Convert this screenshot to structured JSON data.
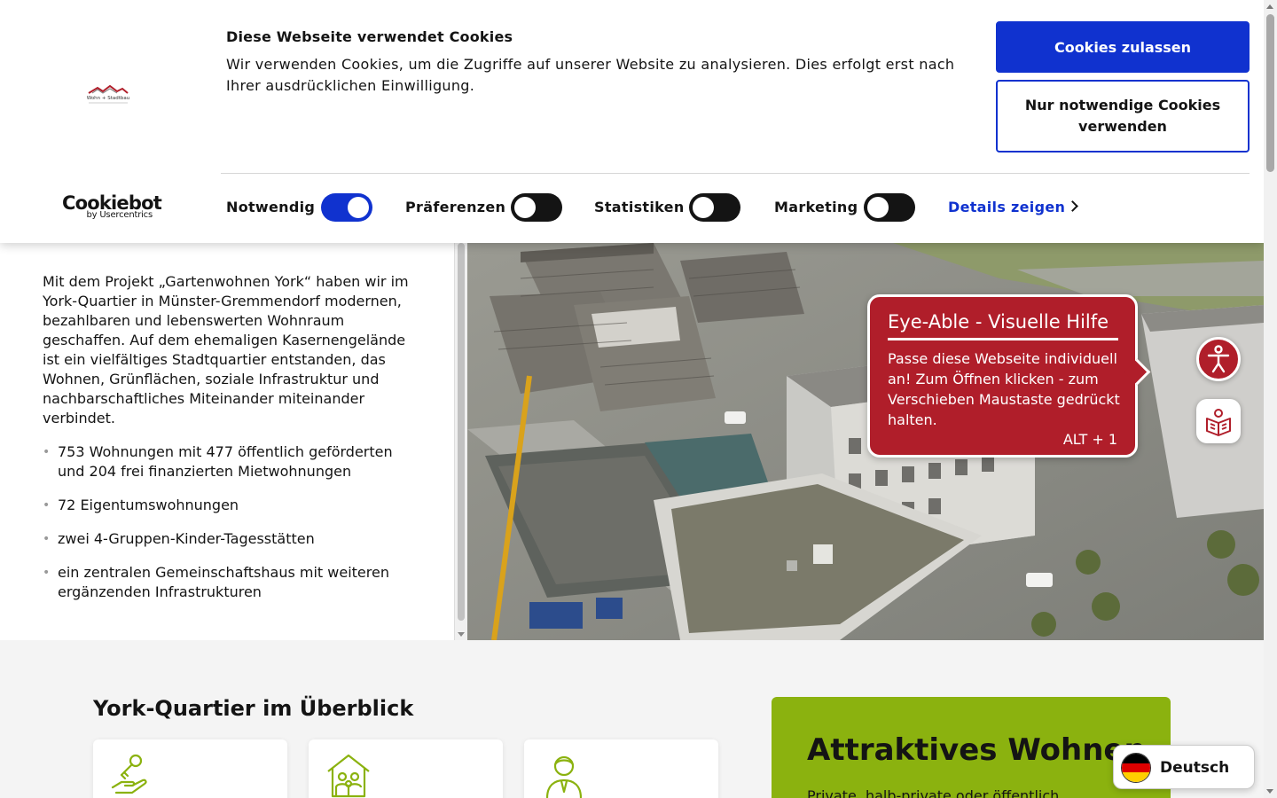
{
  "cookie_banner": {
    "title": "Diese Webseite verwendet Cookies",
    "text": "Wir verwenden Cookies, um die Zugriffe auf unserer Website zu analysieren. Dies erfolgt erst nach Ihrer ausdrücklichen Einwilligung.",
    "allow_label": "Cookies zulassen",
    "necessary_label": "Nur notwendige Cookies verwenden",
    "details_label": "Details zeigen",
    "provider_name": "Cookiebot",
    "provider_sub": "by Usercentrics",
    "site_logo_text": "Wohn + Stadtbau",
    "toggles": [
      {
        "label": "Notwendig",
        "state": "on"
      },
      {
        "label": "Präferenzen",
        "state": "off"
      },
      {
        "label": "Statistiken",
        "state": "off"
      },
      {
        "label": "Marketing",
        "state": "off"
      }
    ]
  },
  "content": {
    "intro": "Mit dem Projekt „Gartenwohnen York“ haben wir im York-Quartier in Münster-Gremmendorf modernen, bezahlbaren und lebenswerten Wohnraum geschaffen. Auf dem ehemaligen Kasernengelände ist ein vielfältiges Stadtquartier entstanden, das Wohnen, Grünflächen, soziale Infrastruktur und nachbarschaftliches Miteinander miteinander verbindet.",
    "bullets": [
      "753 Wohnungen mit 477 öffentlich geförderten und 204 frei finanzierten Mietwohnungen",
      "72 Eigentumswohnungen",
      "zwei 4-Gruppen-Kinder-Tagesstätten",
      "ein zentralen Gemeinschaftshaus mit weiteren ergänzenden Infrastrukturen"
    ]
  },
  "overview": {
    "title": "York-Quartier im Überblick",
    "card_icons": [
      "hand-key-icon",
      "house-family-icon",
      "person-tie-icon"
    ],
    "green_card": {
      "title": "Attraktives Wohnen",
      "text": "Private, halb-private oder öffentlich"
    }
  },
  "eye_able": {
    "title": "Eye-Able - Visuelle Hilfe",
    "text": "Passe diese Webseite individuell an! Zum Öffnen klicken - zum Verschieben Maustaste gedrückt halten.",
    "shortcut": "ALT + 1"
  },
  "language": {
    "label": "Deutsch"
  },
  "colors": {
    "accent_blue": "#1032cf",
    "eye_able_red": "#b01e2a",
    "brand_green": "#8bb20f"
  }
}
